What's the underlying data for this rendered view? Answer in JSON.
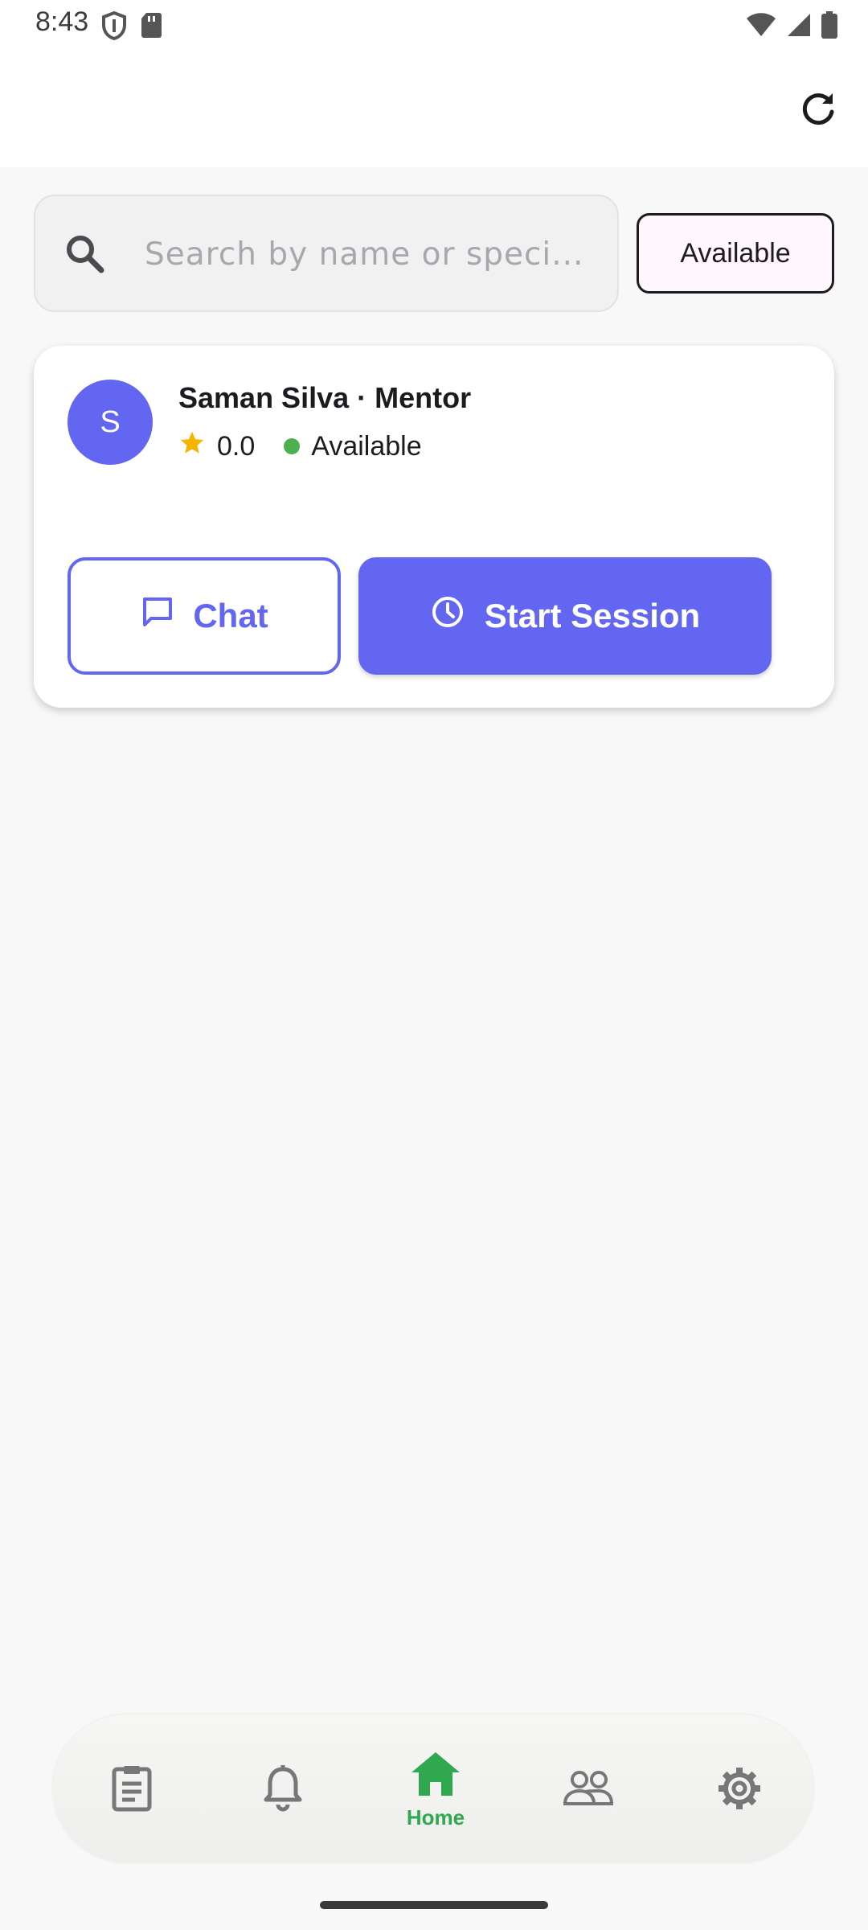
{
  "status_bar": {
    "time": "8:43",
    "left_icons": [
      "shield-icon",
      "sd-card-icon"
    ],
    "right_icons": [
      "wifi-icon",
      "signal-icon",
      "battery-icon"
    ]
  },
  "app_bar": {
    "actions": [
      "refresh-icon"
    ]
  },
  "search": {
    "placeholder": "Search by name or speci...",
    "value": "",
    "icon": "search-icon"
  },
  "filter": {
    "label": "Available"
  },
  "mentors": [
    {
      "avatar_initial": "S",
      "avatar_color": "#6366f1",
      "name_line": "Saman Silva · Mentor",
      "rating": "0.0",
      "status": "Available",
      "status_color": "#4caf50",
      "chat_label": "Chat",
      "start_label": "Start Session"
    }
  ],
  "bottom_nav": {
    "items": [
      {
        "icon": "clipboard-icon",
        "label": ""
      },
      {
        "icon": "bell-icon",
        "label": ""
      },
      {
        "icon": "home-icon",
        "label": "Home",
        "active": true
      },
      {
        "icon": "people-icon",
        "label": ""
      },
      {
        "icon": "gear-icon",
        "label": ""
      }
    ],
    "active_color": "#2fa84f",
    "inactive_color": "#777777"
  },
  "colors": {
    "primary": "#6366f1",
    "accent_green": "#2fa84f",
    "star": "#f6b400"
  }
}
